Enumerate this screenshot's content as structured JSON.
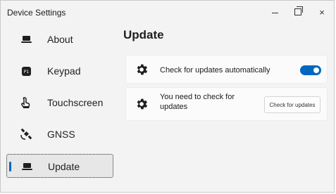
{
  "window": {
    "title": "Device Settings",
    "controls": {
      "minimize": "minimize",
      "maximize": "restore",
      "close": "×"
    }
  },
  "sidebar": {
    "items": [
      {
        "label": "About",
        "icon": "laptop-icon",
        "selected": false
      },
      {
        "label": "Keypad",
        "icon": "keypad-icon",
        "selected": false
      },
      {
        "label": "Touchscreen",
        "icon": "touch-icon",
        "selected": false
      },
      {
        "label": "GNSS",
        "icon": "satellite-icon",
        "selected": false
      },
      {
        "label": "Update",
        "icon": "laptop-icon",
        "selected": true
      }
    ]
  },
  "main": {
    "title": "Update",
    "auto_update": {
      "label": "Check for updates automatically",
      "icon": "gear-icon",
      "toggle_on": true
    },
    "manual_update": {
      "label": "You need to check for updates",
      "icon": "gear-icon",
      "button_label": "Check for updates"
    }
  },
  "colors": {
    "accent": "#0067c0",
    "window_bg": "#f3f3f3",
    "card_bg": "#fbfbfb"
  }
}
